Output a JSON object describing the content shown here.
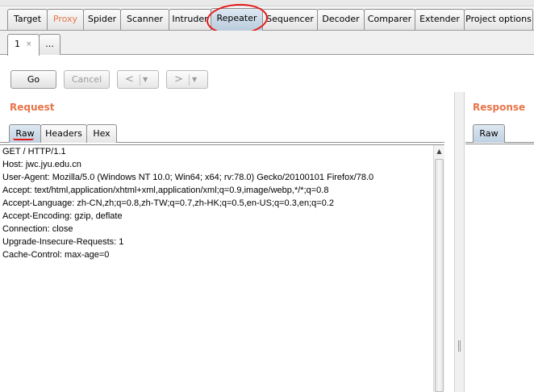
{
  "main_tabs": [
    "Target",
    "Proxy",
    "Spider",
    "Scanner",
    "Intruder",
    "Repeater",
    "Sequencer",
    "Decoder",
    "Comparer",
    "Extender",
    "Project options"
  ],
  "sub_tabs": {
    "first_num": "1",
    "close": "×",
    "more": "..."
  },
  "toolbar": {
    "go": "Go",
    "cancel": "Cancel",
    "back": "<",
    "forward": ">",
    "dropdown": "▼"
  },
  "request": {
    "title": "Request",
    "tabs": [
      "Raw",
      "Headers",
      "Hex"
    ],
    "lines": [
      "GET / HTTP/1.1",
      "Host: jwc.jyu.edu.cn",
      "User-Agent: Mozilla/5.0 (Windows NT 10.0; Win64; x64; rv:78.0) Gecko/20100101 Firefox/78.0",
      "Accept: text/html,application/xhtml+xml,application/xml;q=0.9,image/webp,*/*;q=0.8",
      "Accept-Language: zh-CN,zh;q=0.8,zh-TW;q=0.7,zh-HK;q=0.5,en-US;q=0.3,en;q=0.2",
      "Accept-Encoding: gzip, deflate",
      "Connection: close",
      "Upgrade-Insecure-Requests: 1",
      "Cache-Control: max-age=0"
    ]
  },
  "response": {
    "title": "Response",
    "tabs": [
      "Raw"
    ]
  },
  "scroll": {
    "up": "▲"
  },
  "colors": {
    "accent": "#e8754a",
    "annotation": "#e81818",
    "active_tab": "#c6d5e4"
  }
}
